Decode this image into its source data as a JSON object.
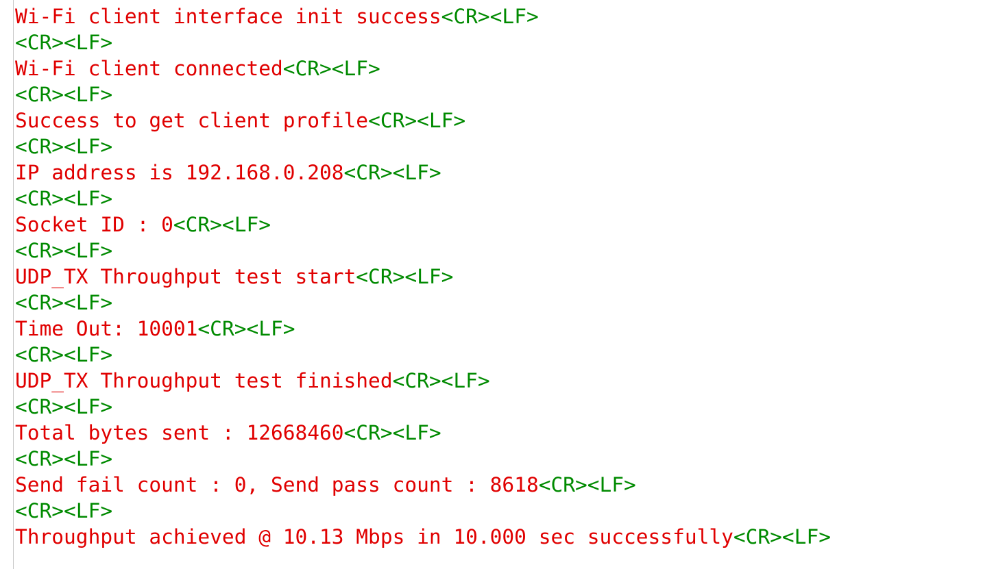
{
  "colors": {
    "text": "#e00000",
    "control_chars": "#008a00",
    "background": "#ffffff"
  },
  "lines": [
    {
      "text": "Wi-Fi client interface init success",
      "ctl": "<CR><LF>"
    },
    {
      "text": "",
      "ctl": "<CR><LF>"
    },
    {
      "text": "Wi-Fi client connected",
      "ctl": "<CR><LF>"
    },
    {
      "text": "",
      "ctl": "<CR><LF>"
    },
    {
      "text": "Success to get client profile",
      "ctl": "<CR><LF>"
    },
    {
      "text": "",
      "ctl": "<CR><LF>"
    },
    {
      "text": "IP address is 192.168.0.208",
      "ctl": "<CR><LF>"
    },
    {
      "text": "",
      "ctl": "<CR><LF>"
    },
    {
      "text": "Socket ID : 0",
      "ctl": "<CR><LF>"
    },
    {
      "text": "",
      "ctl": "<CR><LF>"
    },
    {
      "text": "UDP_TX Throughput test start",
      "ctl": "<CR><LF>"
    },
    {
      "text": "",
      "ctl": "<CR><LF>"
    },
    {
      "text": "Time Out: 10001",
      "ctl": "<CR><LF>"
    },
    {
      "text": "",
      "ctl": "<CR><LF>"
    },
    {
      "text": "UDP_TX Throughput test finished",
      "ctl": "<CR><LF>"
    },
    {
      "text": "",
      "ctl": "<CR><LF>"
    },
    {
      "text": "Total bytes sent : 12668460",
      "ctl": "<CR><LF>"
    },
    {
      "text": "",
      "ctl": "<CR><LF>"
    },
    {
      "text": "Send fail count : 0, Send pass count : 8618",
      "ctl": "<CR><LF>"
    },
    {
      "text": "",
      "ctl": "<CR><LF>"
    },
    {
      "text": "Throughput achieved @ 10.13 Mbps in 10.000 sec successfully",
      "ctl": "<CR><LF>"
    }
  ]
}
